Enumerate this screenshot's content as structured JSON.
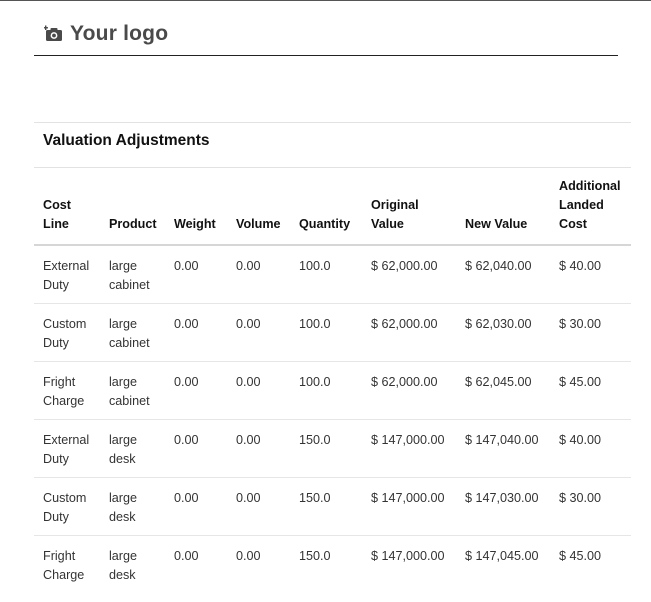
{
  "logo": {
    "text": "Your logo",
    "icon": "camera-icon"
  },
  "section": {
    "title": "Valuation Adjustments"
  },
  "table": {
    "headers": [
      "Cost\nLine",
      "Product",
      "Weight",
      "Volume",
      "Quantity",
      "Original\nValue",
      "New Value",
      "Additional\nLanded\nCost"
    ],
    "rows": [
      [
        "External\nDuty",
        "large\ncabinet",
        "0.00",
        "0.00",
        "100.0",
        "$ 62,000.00",
        "$ 62,040.00",
        "$ 40.00"
      ],
      [
        "Custom\nDuty",
        "large\ncabinet",
        "0.00",
        "0.00",
        "100.0",
        "$ 62,000.00",
        "$ 62,030.00",
        "$ 30.00"
      ],
      [
        "Fright\nCharge",
        "large\ncabinet",
        "0.00",
        "0.00",
        "100.0",
        "$ 62,000.00",
        "$ 62,045.00",
        "$ 45.00"
      ],
      [
        "External\nDuty",
        "large\ndesk",
        "0.00",
        "0.00",
        "150.0",
        "$ 147,000.00",
        "$ 147,040.00",
        "$ 40.00"
      ],
      [
        "Custom\nDuty",
        "large\ndesk",
        "0.00",
        "0.00",
        "150.0",
        "$ 147,000.00",
        "$ 147,030.00",
        "$ 30.00"
      ],
      [
        "Fright\nCharge",
        "large\ndesk",
        "0.00",
        "0.00",
        "150.0",
        "$ 147,000.00",
        "$ 147,045.00",
        "$ 45.00"
      ]
    ]
  }
}
